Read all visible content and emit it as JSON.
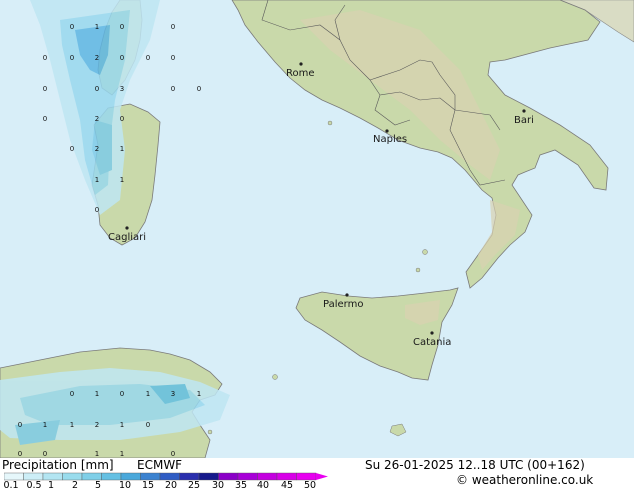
{
  "map": {
    "cities": [
      {
        "name": "Rome"
      },
      {
        "name": "Naples"
      },
      {
        "name": "Bari"
      },
      {
        "name": "Cagliari"
      },
      {
        "name": "Palermo"
      },
      {
        "name": "Catania"
      }
    ],
    "grid_values": [
      "0",
      "1",
      "0",
      "0",
      "0",
      "0",
      "2",
      "0",
      "0",
      "0",
      "0",
      "0",
      "3",
      "0",
      "0",
      "0",
      "2",
      "0",
      "0",
      "2",
      "1",
      "1",
      "1",
      "0",
      "0",
      "1",
      "0",
      "1",
      "3",
      "1",
      "0",
      "1",
      "1",
      "2",
      "1",
      "0",
      "0",
      "0",
      "1",
      "1",
      "0"
    ]
  },
  "footer": {
    "title": "Precipitation [mm]",
    "model": "ECMWF",
    "valid_time": "Su 26-01-2025 12..18 UTC (00+162)",
    "credit": "© weatheronline.co.uk",
    "legend": {
      "labels": [
        "0.1",
        "0.5",
        "1",
        "2",
        "5",
        "10",
        "15",
        "20",
        "25",
        "30",
        "35",
        "40",
        "45",
        "50"
      ],
      "colors": [
        "#e6f7fb",
        "#cdeef7",
        "#b3e5f2",
        "#99dced",
        "#7fcfe8",
        "#64c0e3",
        "#4aa8db",
        "#3b82d0",
        "#2f5cc4",
        "#2a2fae",
        "#161a8c",
        "#8b00c8",
        "#a800d8",
        "#c400e0",
        "#d800e8",
        "#e800f0"
      ]
    }
  }
}
